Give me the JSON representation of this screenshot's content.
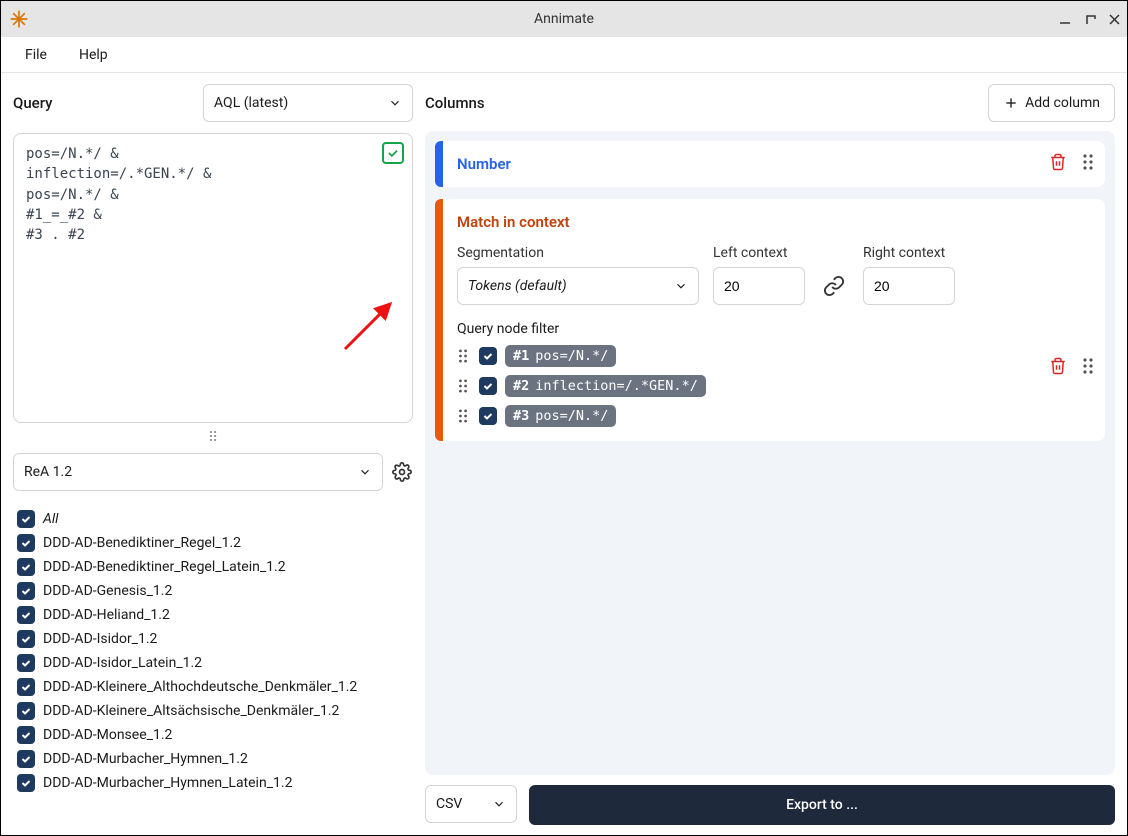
{
  "window": {
    "title": "Annimate"
  },
  "menubar": {
    "file": "File",
    "help": "Help"
  },
  "query": {
    "label": "Query",
    "language": "AQL (latest)",
    "text": "pos=/N.*/ &\ninflection=/.*GEN.*/ &\npos=/N.*/ &\n#1_=_#2 &\n#3 . #2"
  },
  "corpus": {
    "selected_set": "ReA 1.2",
    "all_label": "All",
    "items": [
      "DDD-AD-Benediktiner_Regel_1.2",
      "DDD-AD-Benediktiner_Regel_Latein_1.2",
      "DDD-AD-Genesis_1.2",
      "DDD-AD-Heliand_1.2",
      "DDD-AD-Isidor_1.2",
      "DDD-AD-Isidor_Latein_1.2",
      "DDD-AD-Kleinere_Althochdeutsche_Denkmäler_1.2",
      "DDD-AD-Kleinere_Altsächsische_Denkmäler_1.2",
      "DDD-AD-Monsee_1.2",
      "DDD-AD-Murbacher_Hymnen_1.2",
      "DDD-AD-Murbacher_Hymnen_Latein_1.2"
    ]
  },
  "columns": {
    "label": "Columns",
    "add_label": "Add column",
    "number_card": {
      "title": "Number"
    },
    "match_card": {
      "title": "Match in context",
      "segmentation_label": "Segmentation",
      "segmentation_value": "Tokens (default)",
      "left_label": "Left context",
      "left_value": "20",
      "right_label": "Right context",
      "right_value": "20",
      "qnf_label": "Query node filter",
      "filters": [
        {
          "num": "#1",
          "expr": "pos=/N.*/"
        },
        {
          "num": "#2",
          "expr": "inflection=/.*GEN.*/"
        },
        {
          "num": "#3",
          "expr": "pos=/N.*/"
        }
      ]
    }
  },
  "footer": {
    "format": "CSV",
    "export_label": "Export to ..."
  }
}
